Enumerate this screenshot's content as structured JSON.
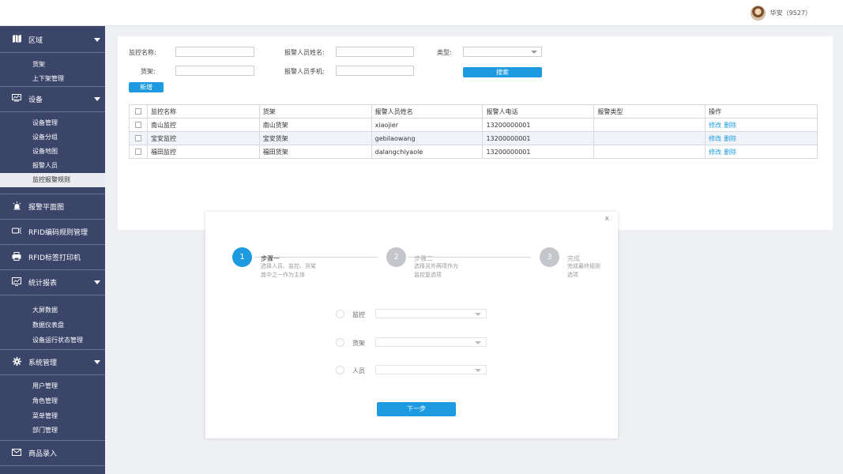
{
  "header": {
    "user_name": "华安（9527）"
  },
  "sidebar": {
    "region": {
      "label": "区域",
      "icon": "map-icon",
      "items": [
        "货架",
        "上下架管理"
      ]
    },
    "device": {
      "label": "设备",
      "icon": "monitor-icon",
      "items": [
        "设备管理",
        "设备分组",
        "设备地图",
        "报警人员",
        "监控报警规则"
      ],
      "active": "监控报警规则"
    },
    "alarm_map": {
      "label": "报警平面图",
      "icon": "alarm-light-icon"
    },
    "rfid_rule": {
      "label": "RFID编码规则管理",
      "icon": "rfid-icon"
    },
    "rfid_print": {
      "label": "RFID标签打印机",
      "icon": "printer-icon"
    },
    "stats": {
      "label": "统计报表",
      "icon": "report-icon",
      "items": [
        "大屏数据",
        "数据仪表盘",
        "设备运行状态管理"
      ]
    },
    "system": {
      "label": "系统管理",
      "icon": "gear-icon",
      "items": [
        "用户管理",
        "角色管理",
        "菜单管理",
        "部门管理"
      ]
    },
    "goods": {
      "label": "商品录入",
      "icon": "mail-icon"
    }
  },
  "filters": {
    "monitor_name_label": "监控名称:",
    "alarm_person_label": "报警人员姓名:",
    "type_label": "类型:",
    "shelf_label": "货架:",
    "alarm_phone_label": "报警人员手机:",
    "search_button": "搜索",
    "add_button": "新增"
  },
  "table": {
    "columns": [
      "监控名称",
      "货架",
      "报警人员姓名",
      "报警人电话",
      "报警类型",
      "操作"
    ],
    "rows": [
      {
        "name": "南山监控",
        "shelf": "南山货架",
        "person": "xiaojier",
        "phone": "13200000001",
        "type": ""
      },
      {
        "name": "宝安监控",
        "shelf": "宝安货架",
        "person": "gebilaowang",
        "phone": "13200000001",
        "type": ""
      },
      {
        "name": "福田监控",
        "shelf": "福田货架",
        "person": "dalangchiyaole",
        "phone": "13200000001",
        "type": ""
      }
    ],
    "edit_label": "修改",
    "delete_label": "删除"
  },
  "modal": {
    "close": "x",
    "steps": [
      {
        "num": "1",
        "title": "步骤一",
        "desc": "选择人员、监控、货架其中之一作为主体",
        "active": true
      },
      {
        "num": "2",
        "title": "步骤二",
        "desc": "选择另外两项作为监控复选项",
        "active": false
      },
      {
        "num": "3",
        "title": "完成",
        "desc": "完成最终规则选项",
        "active": false
      }
    ],
    "options": [
      "监控",
      "货架",
      "人员"
    ],
    "next_button": "下一步"
  },
  "colors": {
    "sidebar_bg": "#3b4569",
    "accent": "#1e9be0",
    "step_inactive": "#c4c6cb"
  }
}
